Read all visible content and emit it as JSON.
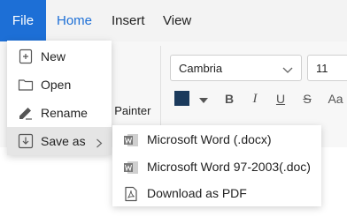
{
  "menubar": {
    "tabs": [
      {
        "label": "File"
      },
      {
        "label": "Home"
      },
      {
        "label": "Insert"
      },
      {
        "label": "View"
      }
    ]
  },
  "ribbon": {
    "font_family": "Cambria",
    "font_size": "11",
    "text_color": "#1b3a5c",
    "format_buttons": {
      "bold": "B",
      "italic": "I",
      "underline": "U",
      "strikethrough": "S",
      "case": "Aa"
    },
    "format_painter_label": ": Painter"
  },
  "file_menu": {
    "items": [
      {
        "label": "New",
        "icon": "new-file-icon"
      },
      {
        "label": "Open",
        "icon": "folder-icon"
      },
      {
        "label": "Rename",
        "icon": "edit-icon"
      },
      {
        "label": "Save as",
        "icon": "download-icon"
      }
    ]
  },
  "save_as_submenu": {
    "items": [
      {
        "label": "Microsoft Word (.docx)",
        "icon": "word-icon"
      },
      {
        "label": "Microsoft Word 97-2003(.doc)",
        "icon": "word-icon"
      },
      {
        "label": "Download as PDF",
        "icon": "pdf-icon"
      }
    ]
  },
  "colors": {
    "accent": "#1d6fd6",
    "menubar_bg": "#f3f3f3",
    "hover_bg": "#e5e5e5"
  }
}
